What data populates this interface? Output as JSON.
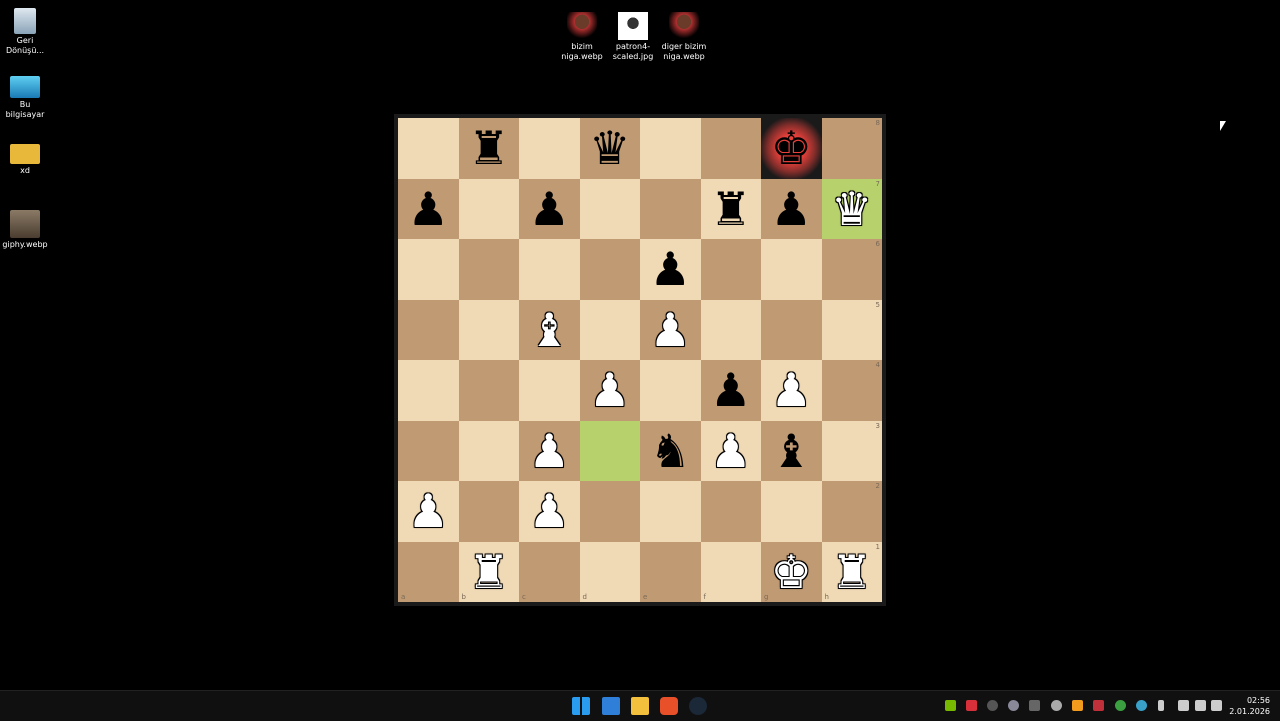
{
  "desktop": {
    "icons": [
      {
        "label": "Geri Dönüşü...",
        "icon": "recycle-bin-icon"
      },
      {
        "label": "Bu bilgisayar",
        "icon": "monitor-icon"
      },
      {
        "label": "xd",
        "icon": "folder-icon"
      },
      {
        "label": "giphy.webp",
        "icon": "image-file-icon"
      }
    ],
    "top_icons": [
      {
        "label": "bizim niga.webp",
        "icon": "image-file-icon"
      },
      {
        "label": "patron4-scaled.jpg",
        "icon": "image-file-icon"
      },
      {
        "label": "diger bizim niga.webp",
        "icon": "image-file-icon"
      }
    ]
  },
  "board": {
    "ranks": [
      "8",
      "7",
      "6",
      "5",
      "4",
      "3",
      "2",
      "1"
    ],
    "files": [
      "a",
      "b",
      "c",
      "d",
      "e",
      "f",
      "g",
      "h"
    ]
  },
  "taskbar": {
    "apps": [
      "start-icon",
      "desktop-app-icon",
      "file-explorer-icon",
      "brave-browser-icon",
      "steam-icon"
    ],
    "time": "02:56",
    "date": "2.01.2026"
  }
}
